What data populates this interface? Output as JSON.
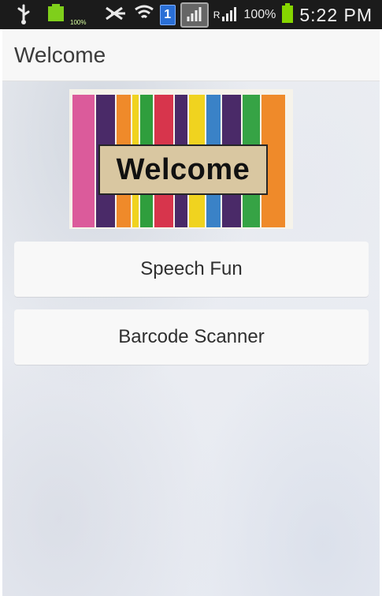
{
  "status_bar": {
    "battery_small_label": "100%",
    "notification_badge": "1",
    "roaming_label": "R",
    "battery_percent": "100%",
    "time": "5:22 PM",
    "icons": [
      "usb-icon",
      "battery-icon",
      "mute-icon",
      "wifi-icon",
      "signal-icon"
    ]
  },
  "app_bar": {
    "title": "Welcome"
  },
  "mat_image": {
    "text": "Welcome"
  },
  "buttons": [
    {
      "label": "Speech Fun"
    },
    {
      "label": "Barcode Scanner"
    }
  ],
  "colors": {
    "status_bar_bg": "#1b1b1b",
    "app_bar_bg": "#f7f7f7",
    "button_bg": "#f8f8f8",
    "text": "#3b3b3b"
  }
}
